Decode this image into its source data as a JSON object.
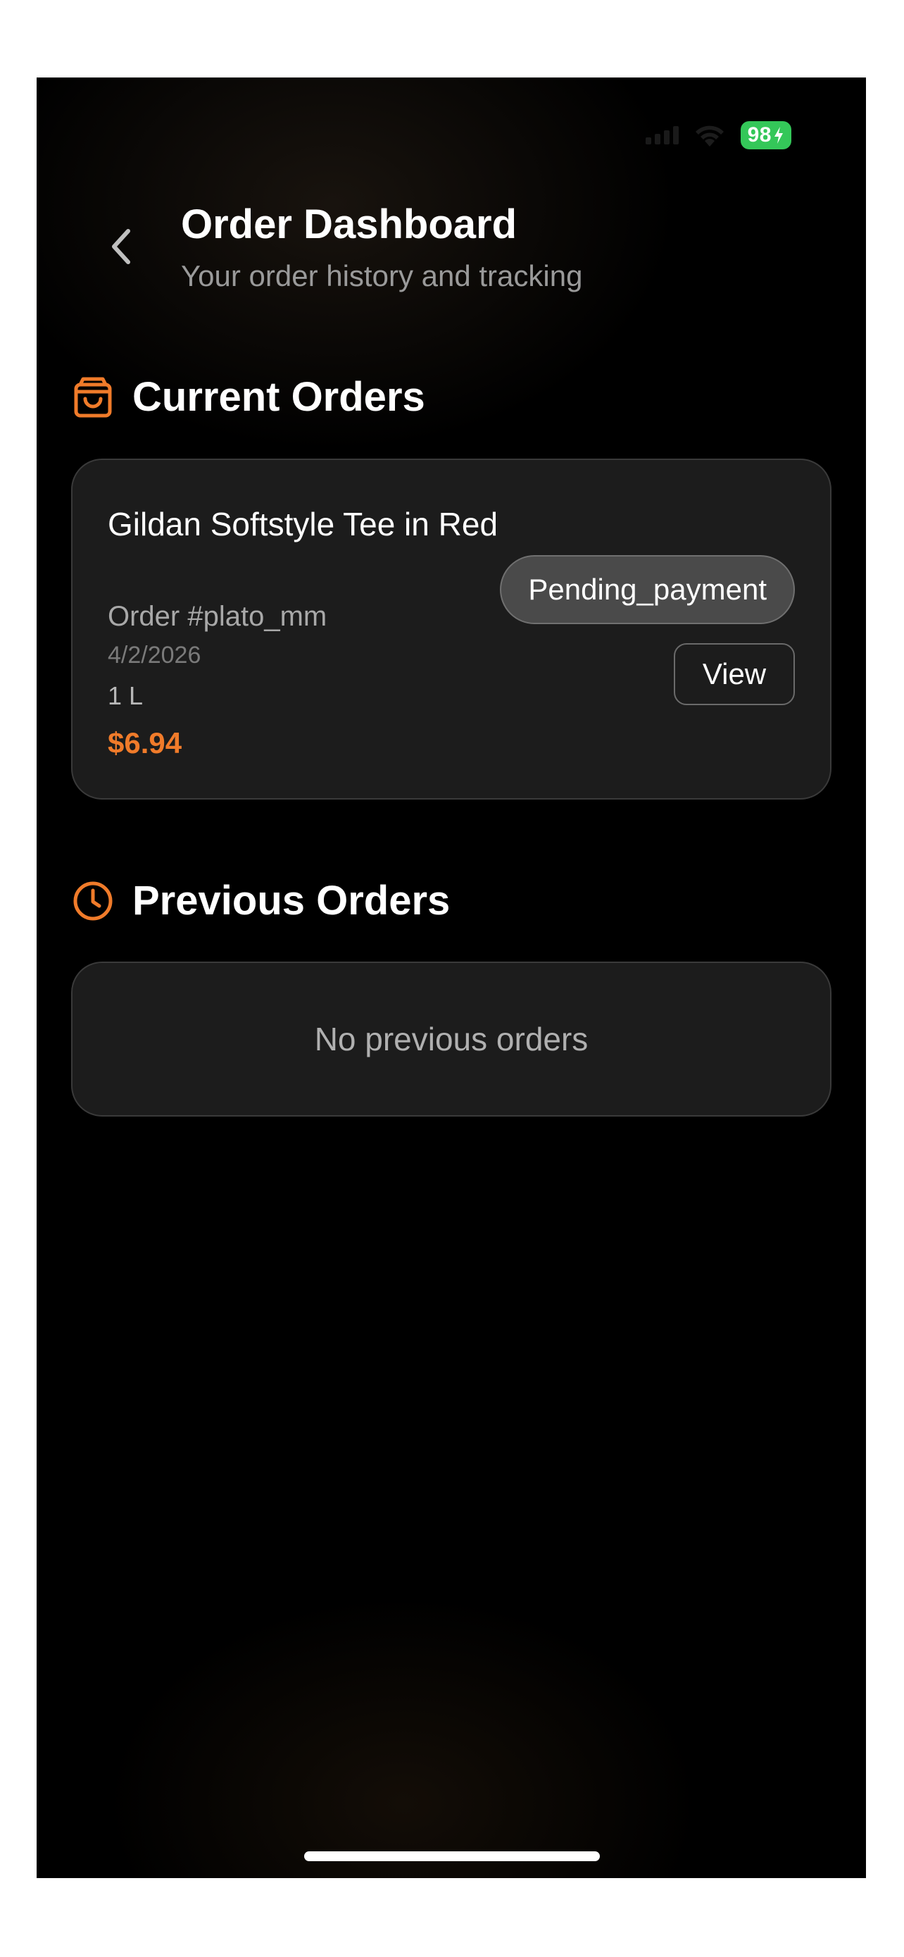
{
  "status_bar": {
    "battery": "98"
  },
  "header": {
    "title": "Order Dashboard",
    "subtitle": "Your order history and tracking",
    "back_icon": "chevron-left-icon"
  },
  "current_orders": {
    "title": "Current Orders",
    "icon": "shopping-bag-icon",
    "items": [
      {
        "product": "Gildan Softstyle Tee in Red",
        "order_number": "Order #plato_mm",
        "date": "4/2/2026",
        "size": "1 L",
        "price": "$6.94",
        "status": "Pending_payment",
        "action_label": "View"
      }
    ]
  },
  "previous_orders": {
    "title": "Previous Orders",
    "icon": "clock-icon",
    "empty_text": "No previous orders"
  },
  "colors": {
    "accent": "#f07b2a",
    "battery": "#34c759",
    "card_bg": "#1c1c1c"
  }
}
